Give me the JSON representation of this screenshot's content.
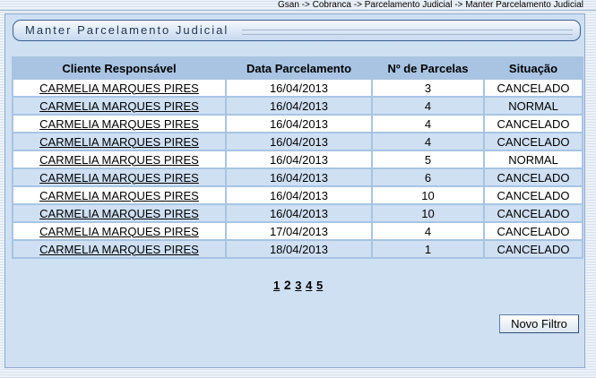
{
  "breadcrumb": "Gsan -> Cobranca -> Parcelamento Judicial -> Manter Parcelamento Judicial",
  "panel_title": "Manter Parcelamento Judicial",
  "table": {
    "headers": [
      "Cliente Responsável",
      "Data Parcelamento",
      "Nº de Parcelas",
      "Situação"
    ],
    "rows": [
      [
        "CARMELIA MARQUES PIRES",
        "16/04/2013",
        "3",
        "CANCELADO"
      ],
      [
        "CARMELIA MARQUES PIRES",
        "16/04/2013",
        "4",
        "NORMAL"
      ],
      [
        "CARMELIA MARQUES PIRES",
        "16/04/2013",
        "4",
        "CANCELADO"
      ],
      [
        "CARMELIA MARQUES PIRES",
        "16/04/2013",
        "4",
        "CANCELADO"
      ],
      [
        "CARMELIA MARQUES PIRES",
        "16/04/2013",
        "5",
        "NORMAL"
      ],
      [
        "CARMELIA MARQUES PIRES",
        "16/04/2013",
        "6",
        "CANCELADO"
      ],
      [
        "CARMELIA MARQUES PIRES",
        "16/04/2013",
        "10",
        "CANCELADO"
      ],
      [
        "CARMELIA MARQUES PIRES",
        "16/04/2013",
        "10",
        "CANCELADO"
      ],
      [
        "CARMELIA MARQUES PIRES",
        "17/04/2013",
        "4",
        "CANCELADO"
      ],
      [
        "CARMELIA MARQUES PIRES",
        "18/04/2013",
        "1",
        "CANCELADO"
      ]
    ]
  },
  "pagination": {
    "pages": [
      "1",
      "2",
      "3",
      "4",
      "5"
    ],
    "current": "2"
  },
  "new_filter_button": "Novo Filtro",
  "colors": {
    "panel_bg": "#cfe0f3",
    "header_bg": "#a8c4e2",
    "row_white": "#ffffff",
    "row_blue": "#cfe0f3"
  }
}
